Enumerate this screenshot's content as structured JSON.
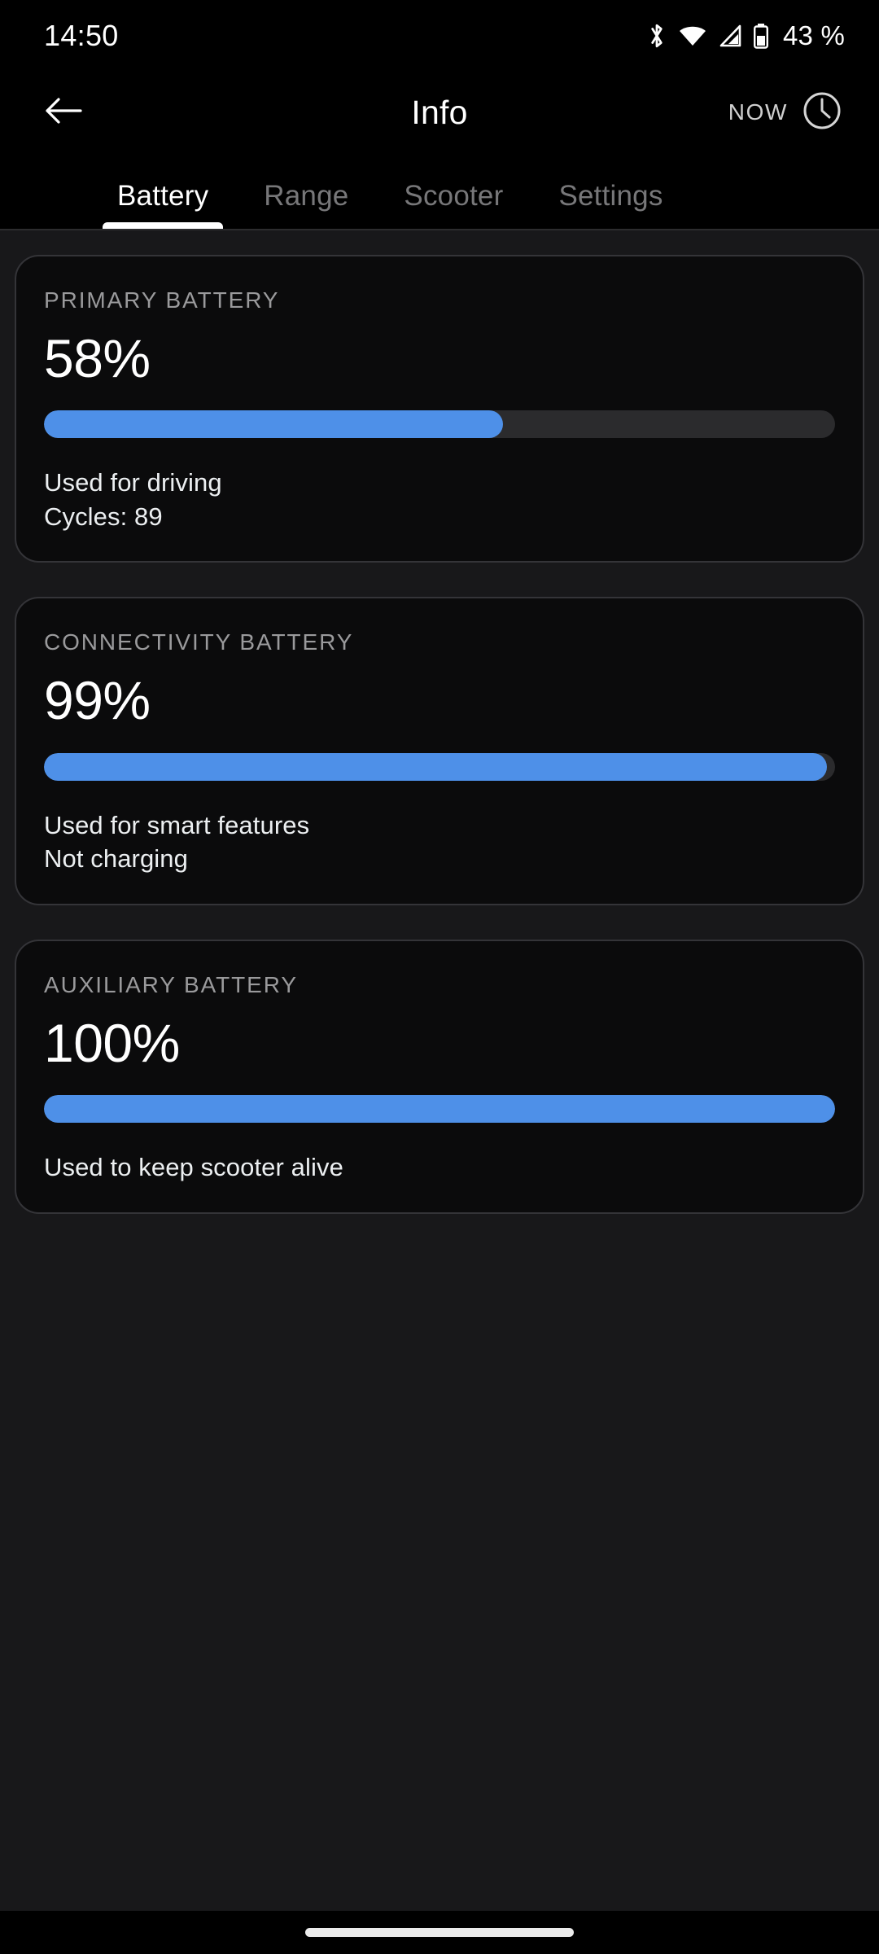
{
  "status_bar": {
    "time": "14:50",
    "battery_text": "43 %",
    "icons": [
      "bluetooth-icon",
      "wifi-icon",
      "cellular-signal-icon",
      "battery-icon"
    ]
  },
  "app_bar": {
    "back_icon": "back-arrow-icon",
    "title": "Info",
    "now_label": "NOW",
    "clock_icon": "clock-icon"
  },
  "tabs": {
    "active_index": 0,
    "items": [
      {
        "label": "Battery"
      },
      {
        "label": "Range"
      },
      {
        "label": "Scooter"
      },
      {
        "label": "Settings"
      }
    ]
  },
  "colors": {
    "accent": "#4e90e8",
    "track": "#2b2b2d",
    "card_bg": "#0b0b0c",
    "card_border": "#343438",
    "page_bg": "#18181a",
    "muted_text": "#9a9a9c"
  },
  "cards": [
    {
      "label": "PRIMARY BATTERY",
      "value": "58%",
      "percent": 58,
      "line1": "Used for driving",
      "line2": "Cycles: 89"
    },
    {
      "label": "CONNECTIVITY BATTERY",
      "value": "99%",
      "percent": 99,
      "line1": "Used for smart features",
      "line2": "Not charging"
    },
    {
      "label": "AUXILIARY BATTERY",
      "value": "100%",
      "percent": 100,
      "line1": "Used to keep scooter alive",
      "line2": ""
    }
  ]
}
